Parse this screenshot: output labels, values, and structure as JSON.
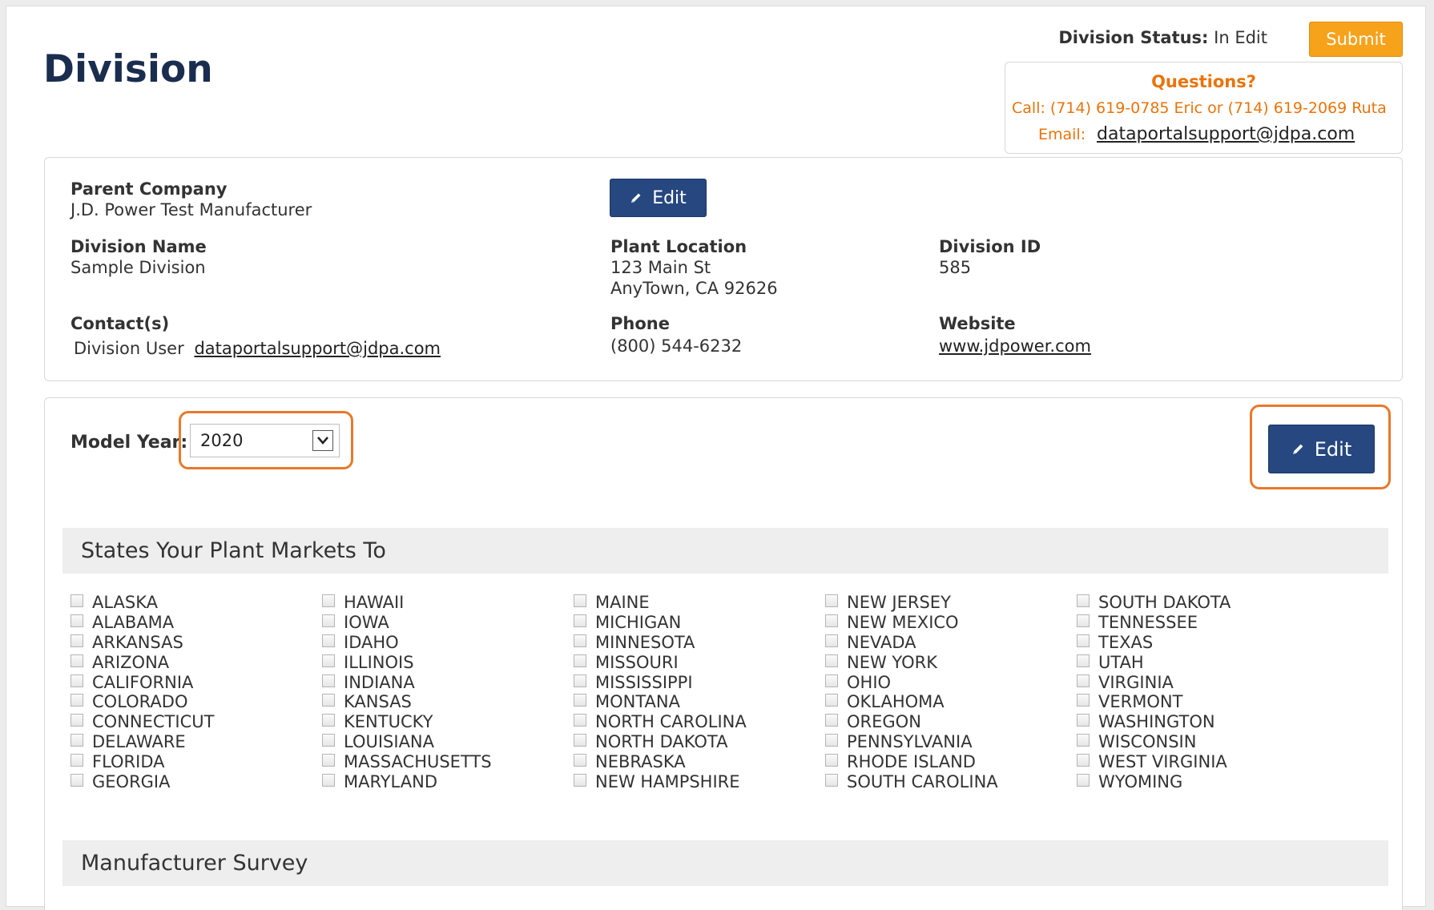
{
  "page": {
    "title": "Division"
  },
  "status": {
    "label": "Division Status:",
    "value": "In Edit",
    "submit_label": "Submit"
  },
  "questions": {
    "title": "Questions?",
    "call": "Call: (714) 619-0785 Eric or (714) 619-2069 Ruta",
    "email_label": "Email:",
    "email": "dataportalsupport@jdpa.com"
  },
  "division": {
    "edit_label": "Edit",
    "parent_company_label": "Parent Company",
    "parent_company": "J.D. Power Test Manufacturer",
    "division_name_label": "Division Name",
    "division_name": "Sample Division",
    "plant_location_label": "Plant Location",
    "plant_address_1": "123 Main St",
    "plant_address_2": "AnyTown, CA 92626",
    "division_id_label": "Division ID",
    "division_id": "585",
    "contacts_label": "Contact(s)",
    "contact_name": "Division User",
    "contact_email": "dataportalsupport@jdpa.com",
    "phone_label": "Phone",
    "phone": "(800) 544-6232",
    "website_label": "Website",
    "website": "www.jdpower.com"
  },
  "model_year": {
    "label": "Model Year:",
    "selected": "2020",
    "edit_label": "Edit"
  },
  "states_section": {
    "title": "States Your Plant Markets To",
    "columns": [
      [
        "ALASKA",
        "ALABAMA",
        "ARKANSAS",
        "ARIZONA",
        "CALIFORNIA",
        "COLORADO",
        "CONNECTICUT",
        "DELAWARE",
        "FLORIDA",
        "GEORGIA"
      ],
      [
        "HAWAII",
        "IOWA",
        "IDAHO",
        "ILLINOIS",
        "INDIANA",
        "KANSAS",
        "KENTUCKY",
        "LOUISIANA",
        "MASSACHUSETTS",
        "MARYLAND"
      ],
      [
        "MAINE",
        "MICHIGAN",
        "MINNESOTA",
        "MISSOURI",
        "MISSISSIPPI",
        "MONTANA",
        "NORTH CAROLINA",
        "NORTH DAKOTA",
        "NEBRASKA",
        "NEW HAMPSHIRE"
      ],
      [
        "NEW JERSEY",
        "NEW MEXICO",
        "NEVADA",
        "NEW YORK",
        "OHIO",
        "OKLAHOMA",
        "OREGON",
        "PENNSYLVANIA",
        "RHODE ISLAND",
        "SOUTH CAROLINA"
      ],
      [
        "SOUTH DAKOTA",
        "TENNESSEE",
        "TEXAS",
        "UTAH",
        "VIRGINIA",
        "VERMONT",
        "WASHINGTON",
        "WISCONSIN",
        "WEST VIRGINIA",
        "WYOMING"
      ]
    ]
  },
  "survey_section": {
    "title": "Manufacturer Survey"
  },
  "colors": {
    "title": "#1a2d4f",
    "accent_orange": "#f7a21b",
    "button_blue": "#26477f",
    "highlight": "#e8792a",
    "question_text": "#e8740c"
  },
  "icons": {
    "edit": "pencil-icon",
    "dropdown": "chevron-down-icon"
  }
}
